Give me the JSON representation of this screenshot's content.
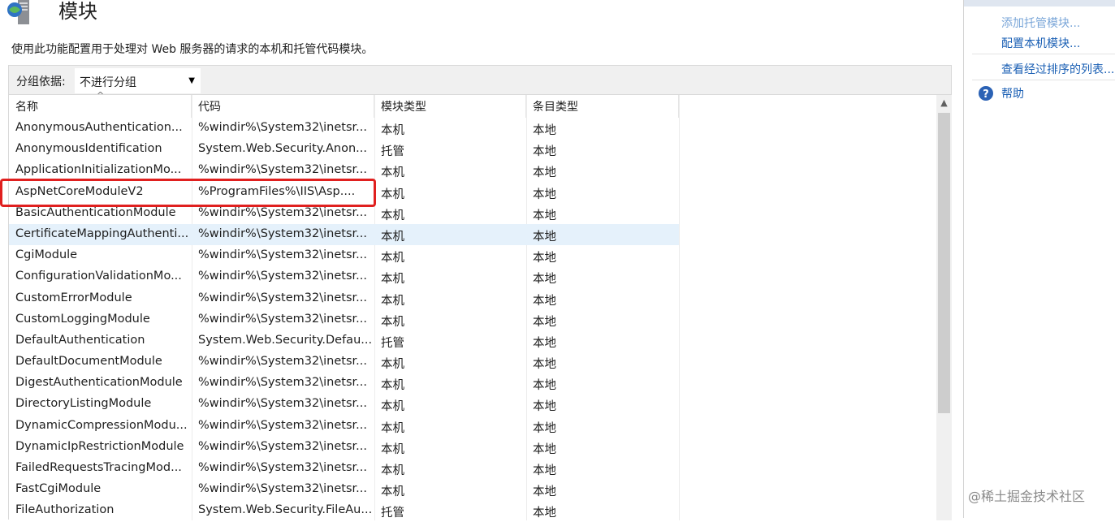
{
  "header": {
    "title": "模块",
    "description": "使用此功能配置用于处理对 Web 服务器的请求的本机和托管代码模块。",
    "icon": "server-modules-icon"
  },
  "toolbar": {
    "group_by_label": "分组依据:",
    "group_by_value": "不进行分组"
  },
  "columns": [
    "名称",
    "代码",
    "模块类型",
    "条目类型"
  ],
  "rows": [
    {
      "name": "AnonymousAuthentication...",
      "code": "%windir%\\System32\\inetsr...",
      "module_type": "本机",
      "entry_type": "本地"
    },
    {
      "name": "AnonymousIdentification",
      "code": "System.Web.Security.Anon...",
      "module_type": "托管",
      "entry_type": "本地"
    },
    {
      "name": "ApplicationInitializationMo...",
      "code": "%windir%\\System32\\inetsr...",
      "module_type": "本机",
      "entry_type": "本地"
    },
    {
      "name": "AspNetCoreModuleV2",
      "code": "%ProgramFiles%\\IIS\\Asp....",
      "module_type": "本机",
      "entry_type": "本地"
    },
    {
      "name": "BasicAuthenticationModule",
      "code": "%windir%\\System32\\inetsr...",
      "module_type": "本机",
      "entry_type": "本地"
    },
    {
      "name": "CertificateMappingAuthenti...",
      "code": "%windir%\\System32\\inetsr...",
      "module_type": "本机",
      "entry_type": "本地"
    },
    {
      "name": "CgiModule",
      "code": "%windir%\\System32\\inetsr...",
      "module_type": "本机",
      "entry_type": "本地"
    },
    {
      "name": "ConfigurationValidationMo...",
      "code": "%windir%\\System32\\inetsr...",
      "module_type": "本机",
      "entry_type": "本地"
    },
    {
      "name": "CustomErrorModule",
      "code": "%windir%\\System32\\inetsr...",
      "module_type": "本机",
      "entry_type": "本地"
    },
    {
      "name": "CustomLoggingModule",
      "code": "%windir%\\System32\\inetsr...",
      "module_type": "本机",
      "entry_type": "本地"
    },
    {
      "name": "DefaultAuthentication",
      "code": "System.Web.Security.Defau...",
      "module_type": "托管",
      "entry_type": "本地"
    },
    {
      "name": "DefaultDocumentModule",
      "code": "%windir%\\System32\\inetsr...",
      "module_type": "本机",
      "entry_type": "本地"
    },
    {
      "name": "DigestAuthenticationModule",
      "code": "%windir%\\System32\\inetsr...",
      "module_type": "本机",
      "entry_type": "本地"
    },
    {
      "name": "DirectoryListingModule",
      "code": "%windir%\\System32\\inetsr...",
      "module_type": "本机",
      "entry_type": "本地"
    },
    {
      "name": "DynamicCompressionModu...",
      "code": "%windir%\\System32\\inetsr...",
      "module_type": "本机",
      "entry_type": "本地"
    },
    {
      "name": "DynamicIpRestrictionModule",
      "code": "%windir%\\System32\\inetsr...",
      "module_type": "本机",
      "entry_type": "本地"
    },
    {
      "name": "FailedRequestsTracingMod...",
      "code": "%windir%\\System32\\inetsr...",
      "module_type": "本机",
      "entry_type": "本地"
    },
    {
      "name": "FastCgiModule",
      "code": "%windir%\\System32\\inetsr...",
      "module_type": "本机",
      "entry_type": "本地"
    },
    {
      "name": "FileAuthorization",
      "code": "System.Web.Security.FileAu...",
      "module_type": "托管",
      "entry_type": "本地"
    }
  ],
  "selected_row": "CertificateMappingAuthenti...",
  "actions": {
    "add_managed_module": "添加托管模块...",
    "configure_native_modules": "配置本机模块...",
    "view_ordered_list": "查看经过排序的列表...",
    "help": "帮助"
  },
  "watermark": "@稀土掘金技术社区",
  "colors": {
    "highlight_box": "#e0201f",
    "link": "#1a5fb4",
    "selection": "#e5f1fb"
  }
}
